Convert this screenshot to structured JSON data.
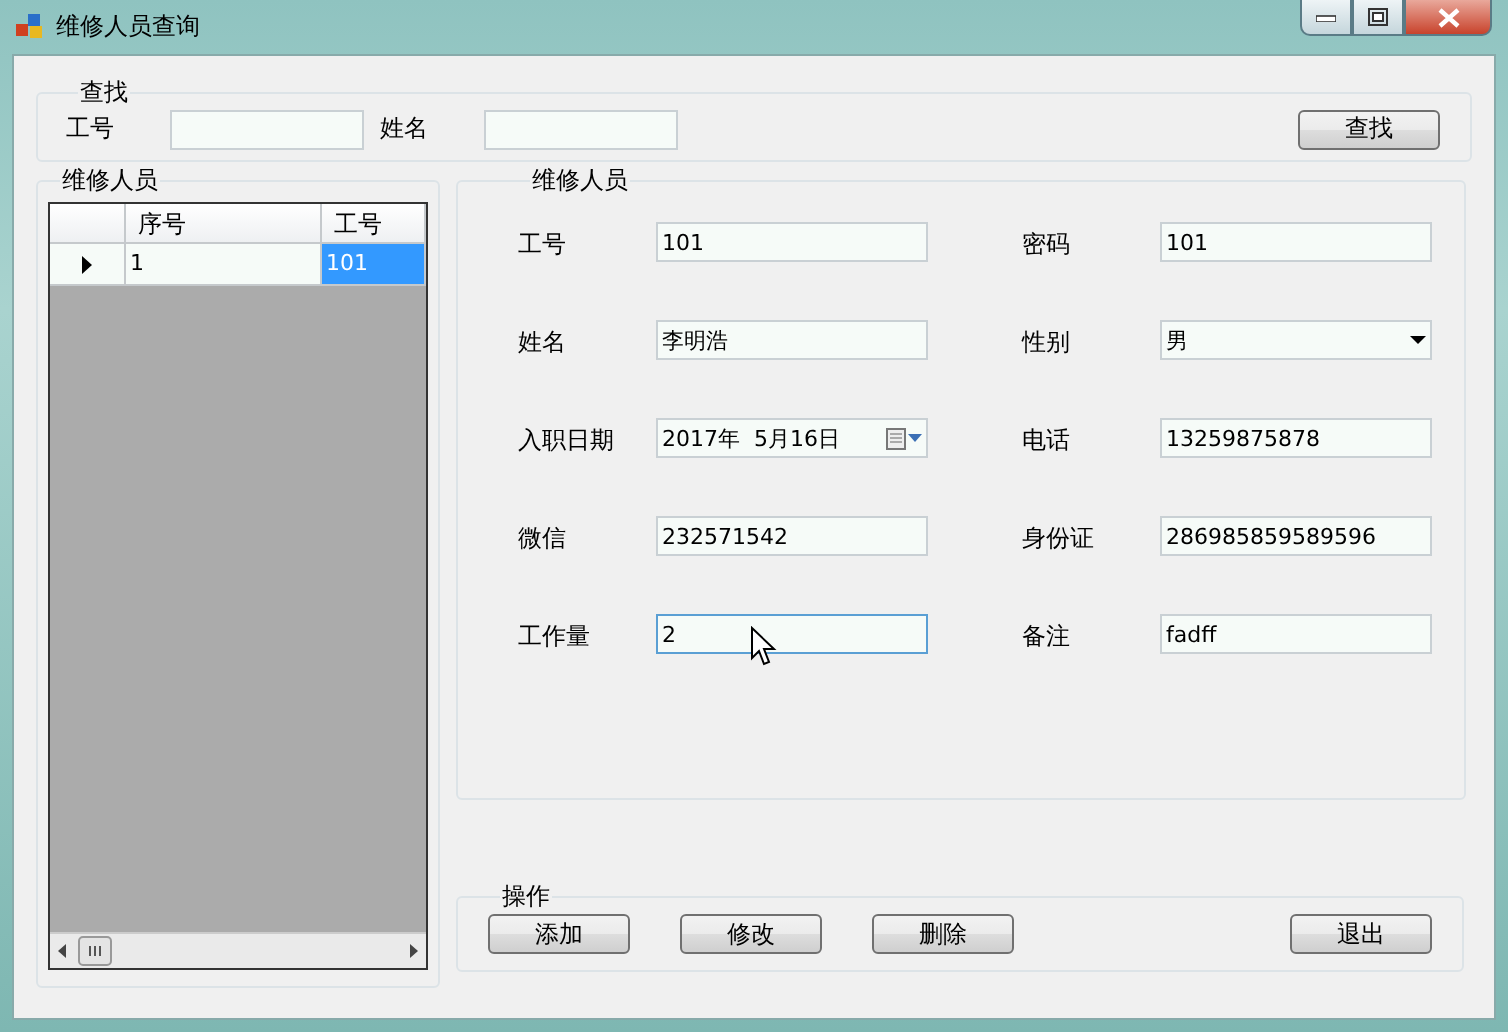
{
  "window": {
    "title": "维修人员查询"
  },
  "search": {
    "title": "查找",
    "fields": [
      {
        "label": "工号"
      },
      {
        "label": "姓名"
      }
    ],
    "button": "查找"
  },
  "list": {
    "title": "维修人员",
    "columns": [
      "序号",
      "工号"
    ],
    "rows": [
      {
        "selected": true,
        "cells": [
          {
            "text": "1",
            "selected": false
          },
          {
            "text": "101",
            "selected": true
          }
        ]
      }
    ]
  },
  "details": {
    "title": "维修人员",
    "fields": [
      {
        "label": "工号",
        "value": "101",
        "kind": "text",
        "focused": false
      },
      {
        "label": "密码",
        "value": "101",
        "kind": "text",
        "focused": false
      },
      {
        "label": "姓名",
        "value": "李明浩",
        "kind": "text",
        "focused": false
      },
      {
        "label": "性别",
        "value": "男",
        "kind": "dropdown",
        "focused": false
      },
      {
        "label": "入职日期",
        "value": "2017年  5月16日",
        "kind": "date",
        "focused": false
      },
      {
        "label": "电话",
        "value": "13259875878",
        "kind": "text",
        "focused": false
      },
      {
        "label": "微信",
        "value": "232571542",
        "kind": "text",
        "focused": false
      },
      {
        "label": "身份证",
        "value": "286985859589596",
        "kind": "text",
        "focused": false
      },
      {
        "label": "工作量",
        "value": "2",
        "kind": "text",
        "focused": true
      },
      {
        "label": "备注",
        "value": "fadff",
        "kind": "text",
        "focused": false
      }
    ]
  },
  "actions": {
    "title": "操作",
    "buttons": [
      "添加",
      "修改",
      "删除",
      "退出"
    ]
  }
}
